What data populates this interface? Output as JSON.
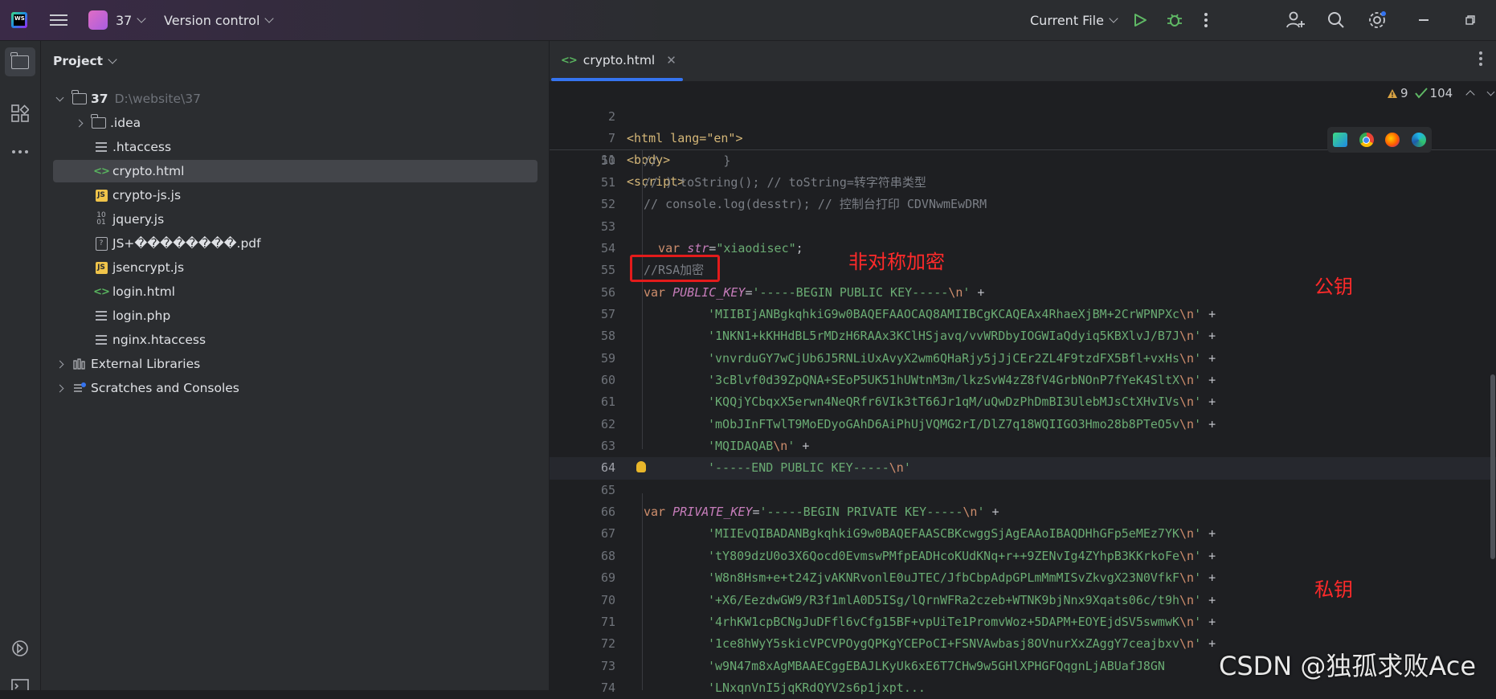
{
  "titlebar": {
    "project_badge": "WS",
    "project_name": "37",
    "vcs_label": "Version control",
    "run_config": "Current File"
  },
  "project_panel": {
    "title": "Project",
    "root": {
      "name": "37",
      "path": "D:\\website\\37"
    },
    "items": [
      {
        "name": ".idea",
        "type": "folder"
      },
      {
        "name": ".htaccess",
        "type": "text"
      },
      {
        "name": "crypto.html",
        "type": "html",
        "selected": true
      },
      {
        "name": "crypto-js.js",
        "type": "js"
      },
      {
        "name": "jquery.js",
        "type": "js-lib"
      },
      {
        "name": "JS+��������.pdf",
        "type": "pdf"
      },
      {
        "name": "jsencrypt.js",
        "type": "js"
      },
      {
        "name": "login.html",
        "type": "html"
      },
      {
        "name": "login.php",
        "type": "text"
      },
      {
        "name": "nginx.htaccess",
        "type": "text"
      }
    ],
    "external": "External Libraries",
    "scratches": "Scratches and Consoles"
  },
  "editor": {
    "tab_label": "crypto.html",
    "warnings": "9",
    "checks": "104",
    "sticky": [
      {
        "ln": "2",
        "text": "<html lang=\"en\">"
      },
      {
        "ln": "7",
        "text": "<body>"
      },
      {
        "ln": "11",
        "text": "<script>"
      }
    ],
    "lines": [
      {
        "ln": "50",
        "text": "//         }"
      },
      {
        "ln": "51",
        "text": "// ).toString(); // toString=转字符串类型"
      },
      {
        "ln": "52",
        "text": "// console.log(desstr); // 控制台打印 CDVNwmEwDRM"
      },
      {
        "ln": "53",
        "text": ""
      },
      {
        "ln": "54",
        "pre": "  var ",
        "var": "str",
        "post": "=",
        "str": "\"xiaodisec\"",
        "tail": ";"
      },
      {
        "ln": "55",
        "text": "//RSA加密"
      },
      {
        "ln": "56",
        "pre": "var ",
        "var": "PUBLIC_KEY",
        "post": "=",
        "str": "'-----BEGIN PUBLIC KEY-----",
        "esc": "\\n",
        "strend": "'",
        "tail": " +"
      },
      {
        "ln": "57",
        "str": "'MIIBIjANBgkqhkiG9w0BAQEFAAOCAQ8AMIIBCgKCAQEAx4RhaeXjBM+2CrWPNPXc",
        "esc": "\\n",
        "strend": "'",
        "tail": " +"
      },
      {
        "ln": "58",
        "str": "'1NKN1+kKHHdBL5rMDzH6RAAx3KClHSjavq/vvWRDbyIOGWIaQdyiq5KBXlvJ/B7J",
        "esc": "\\n",
        "strend": "'",
        "tail": " +"
      },
      {
        "ln": "59",
        "str": "'vnvrduGY7wCjUb6J5RNLiUxAvyX2wm6QHaRjy5jJjCEr2ZL4F9tzdFX5Bfl+vxHs",
        "esc": "\\n",
        "strend": "'",
        "tail": " +"
      },
      {
        "ln": "60",
        "str": "'3cBlvf0d39ZpQNA+SEoP5UK51hUWtnM3m/lkzSvW4zZ8fV4GrbNOnP7fYeK4SltX",
        "esc": "\\n",
        "strend": "'",
        "tail": " +"
      },
      {
        "ln": "61",
        "str": "'KQQjYCbqxX5erwn4NeQRfr6VIk3tT66Jr1qM/uQwDzPhDmBI3UlebMJsCtXHvIVs",
        "esc": "\\n",
        "strend": "'",
        "tail": " +"
      },
      {
        "ln": "62",
        "str": "'mObJInFTwlT9MoEDyoGAhD6AiPhUjVQMG2rI/DlZ7q18WQIIGO3Hmo28b8PTeO5v",
        "esc": "\\n",
        "strend": "'",
        "tail": " +"
      },
      {
        "ln": "63",
        "str": "'MQIDAQAB",
        "esc": "\\n",
        "strend": "'",
        "tail": " +"
      },
      {
        "ln": "64",
        "str": "'-----END PUBLIC KEY-----",
        "esc": "\\n",
        "strend": "'",
        "tail": "",
        "current": true
      },
      {
        "ln": "65",
        "text": ""
      },
      {
        "ln": "66",
        "pre": "var ",
        "var": "PRIVATE_KEY",
        "post": "=",
        "str": "'-----BEGIN PRIVATE KEY-----",
        "esc": "\\n",
        "strend": "'",
        "tail": " +"
      },
      {
        "ln": "67",
        "str": "'MIIEvQIBADANBgkqhkiG9w0BAQEFAASCBKcwggSjAgEAAoIBAQDHhGFp5eMEz7YK",
        "esc": "\\n",
        "strend": "'",
        "tail": " +"
      },
      {
        "ln": "68",
        "str": "'tY809dzU0o3X6Qocd0EvmswPMfpEADHcoKUdKNq+r++9ZENvIg4ZYhpB3KKrkoFe",
        "esc": "\\n",
        "strend": "'",
        "tail": " +"
      },
      {
        "ln": "69",
        "str": "'W8n8Hsm+e+t24ZjvAKNRvonlE0uJTEC/JfbCbpAdpGPLmMmMISvZkvgX23N0VfkF",
        "esc": "\\n",
        "strend": "'",
        "tail": " +"
      },
      {
        "ln": "70",
        "str": "'+X6/EezdwGW9/R3f1mlA0D5ISg/lQrnWFRa2czeb+WTNK9bjNnx9Xqats06c/t9h",
        "esc": "\\n",
        "strend": "'",
        "tail": " +"
      },
      {
        "ln": "71",
        "str": "'4rhKW1cpBCNgJuDFfl6vCfg15BF+vpUiTe1PromvWoz+5DAPM+EOYEjdSV5swmwK",
        "esc": "\\n",
        "strend": "'",
        "tail": " +"
      },
      {
        "ln": "72",
        "str": "'1ce8hWyY5skicVPCVPOygQPKgYCEPoCI+FSNVAwbasj8OVnurXxZAggY7ceajbxv",
        "esc": "\\n",
        "strend": "'",
        "tail": " +"
      },
      {
        "ln": "73",
        "str": "'w9N47m8xAgMBAAECggEBAJLKyUk6xE6T7CHw9w5GHlXPHGFQqgnLjABUafJ8GN",
        "esc": "",
        "strend": "",
        "tail": ""
      },
      {
        "ln": "74",
        "str": "'LNxqnVnI5jqKRdQYV2s6p1jxpt...",
        "esc": "",
        "strend": "",
        "tail": ""
      }
    ]
  },
  "annotations": {
    "asym": "非对称加密",
    "public_key": "公钥",
    "private_key": "私钥",
    "watermark": "CSDN @独孤求败Ace"
  },
  "colors": {
    "annotation": "#ff2a2a",
    "accent": "#3574f0"
  }
}
